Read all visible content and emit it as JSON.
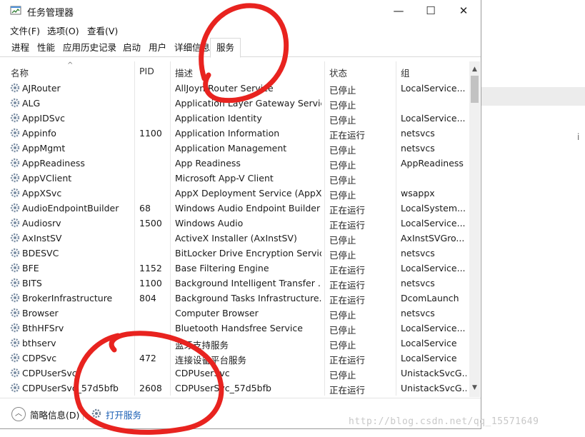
{
  "window": {
    "title": "任务管理器",
    "minimize": "—",
    "maximize": "☐",
    "close": "✕"
  },
  "menu": [
    "文件(F)",
    "选项(O)",
    "查看(V)"
  ],
  "tabs": [
    "进程",
    "性能",
    "应用历史记录",
    "启动",
    "用户",
    "详细信息",
    "服务"
  ],
  "active_tab": "服务",
  "columns": {
    "name": "名称",
    "pid": "PID",
    "desc": "描述",
    "status": "状态",
    "group": "组"
  },
  "services": [
    {
      "name": "AJRouter",
      "pid": "",
      "desc": "AllJoyn Router Service",
      "status": "已停止",
      "group": "LocalService..."
    },
    {
      "name": "ALG",
      "pid": "",
      "desc": "Application Layer Gateway Service",
      "status": "已停止",
      "group": ""
    },
    {
      "name": "AppIDSvc",
      "pid": "",
      "desc": "Application Identity",
      "status": "已停止",
      "group": "LocalService..."
    },
    {
      "name": "Appinfo",
      "pid": "1100",
      "desc": "Application Information",
      "status": "正在运行",
      "group": "netsvcs"
    },
    {
      "name": "AppMgmt",
      "pid": "",
      "desc": "Application Management",
      "status": "已停止",
      "group": "netsvcs"
    },
    {
      "name": "AppReadiness",
      "pid": "",
      "desc": "App Readiness",
      "status": "已停止",
      "group": "AppReadiness"
    },
    {
      "name": "AppVClient",
      "pid": "",
      "desc": "Microsoft App-V Client",
      "status": "已停止",
      "group": ""
    },
    {
      "name": "AppXSvc",
      "pid": "",
      "desc": "AppX Deployment Service (AppX...",
      "status": "已停止",
      "group": "wsappx"
    },
    {
      "name": "AudioEndpointBuilder",
      "pid": "68",
      "desc": "Windows Audio Endpoint Builder",
      "status": "正在运行",
      "group": "LocalSystem..."
    },
    {
      "name": "Audiosrv",
      "pid": "1500",
      "desc": "Windows Audio",
      "status": "正在运行",
      "group": "LocalService..."
    },
    {
      "name": "AxInstSV",
      "pid": "",
      "desc": "ActiveX Installer (AxInstSV)",
      "status": "已停止",
      "group": "AxInstSVGro..."
    },
    {
      "name": "BDESVC",
      "pid": "",
      "desc": "BitLocker Drive Encryption Service",
      "status": "已停止",
      "group": "netsvcs"
    },
    {
      "name": "BFE",
      "pid": "1152",
      "desc": "Base Filtering Engine",
      "status": "正在运行",
      "group": "LocalService..."
    },
    {
      "name": "BITS",
      "pid": "1100",
      "desc": "Background Intelligent Transfer ...",
      "status": "正在运行",
      "group": "netsvcs"
    },
    {
      "name": "BrokerInfrastructure",
      "pid": "804",
      "desc": "Background Tasks Infrastructure...",
      "status": "正在运行",
      "group": "DcomLaunch"
    },
    {
      "name": "Browser",
      "pid": "",
      "desc": "Computer Browser",
      "status": "已停止",
      "group": "netsvcs"
    },
    {
      "name": "BthHFSrv",
      "pid": "",
      "desc": "Bluetooth Handsfree Service",
      "status": "已停止",
      "group": "LocalService..."
    },
    {
      "name": "bthserv",
      "pid": "",
      "desc": "蓝牙支持服务",
      "status": "已停止",
      "group": "LocalService"
    },
    {
      "name": "CDPSvc",
      "pid": "472",
      "desc": "连接设备平台服务",
      "status": "正在运行",
      "group": "LocalService"
    },
    {
      "name": "CDPUserSvc",
      "pid": "",
      "desc": "CDPUserSvc",
      "status": "已停止",
      "group": "UnistackSvcG..."
    },
    {
      "name": "CDPUserSvc_57d5bfb",
      "pid": "2608",
      "desc": "CDPUserSvc_57d5bfb",
      "status": "正在运行",
      "group": "UnistackSvcG..."
    }
  ],
  "footer": {
    "fewer_details": "简略信息(D)",
    "open_services": "打开服务"
  },
  "watermark": "http://blog.csdn.net/qq_15571649",
  "colors": {
    "link": "#1a5fb4",
    "annotation": "#e8231f"
  }
}
